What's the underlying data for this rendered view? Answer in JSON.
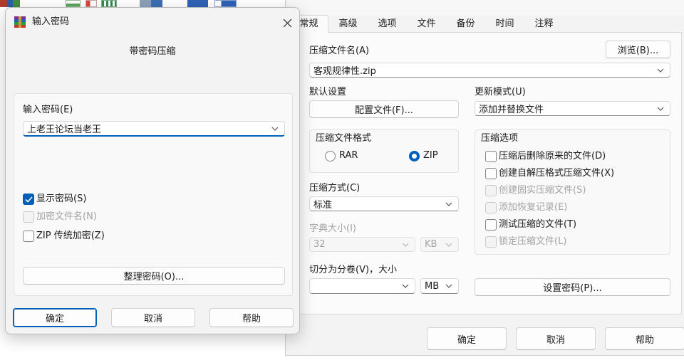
{
  "colors": {
    "accent": "#005fb8"
  },
  "desktop_icons": [
    "archive-file-icon",
    "document-file-icon",
    "image-file-icon",
    "spreadsheet-file-icon",
    "file-icon",
    "word-file-icon",
    "word-file-icon"
  ],
  "archive_dialog": {
    "tabs": [
      {
        "label": "常规",
        "selected": true
      },
      {
        "label": "高级",
        "selected": false
      },
      {
        "label": "选项",
        "selected": false
      },
      {
        "label": "文件",
        "selected": false
      },
      {
        "label": "备份",
        "selected": false
      },
      {
        "label": "时间",
        "selected": false
      },
      {
        "label": "注释",
        "selected": false
      }
    ],
    "archive_name_label": "压缩文件名(A)",
    "browse_button": "浏览(B)...",
    "archive_name_value": "客观规律性.zip",
    "default_settings_label": "默认设置",
    "profiles_button": "配置文件(F)...",
    "update_mode_label": "更新模式(U)",
    "update_mode_value": "添加并替换文件",
    "format_group_label": "压缩文件格式",
    "formats": [
      {
        "label": "RAR",
        "checked": false
      },
      {
        "label": "ZIP",
        "checked": true
      }
    ],
    "method_label": "压缩方式(C)",
    "method_value": "标准",
    "dictionary_label": "字典大小(I)",
    "dictionary_value": "32",
    "dictionary_unit": "KB",
    "dictionary_enabled": false,
    "split_label": "切分为分卷(V)，大小",
    "split_value": "",
    "split_unit": "MB",
    "options_group_label": "压缩选项",
    "options": [
      {
        "label": "压缩后删除原来的文件(D)",
        "checked": false,
        "enabled": true
      },
      {
        "label": "创建自解压格式压缩文件(X)",
        "checked": false,
        "enabled": true
      },
      {
        "label": "创建固实压缩文件(S)",
        "checked": false,
        "enabled": false
      },
      {
        "label": "添加恢复记录(E)",
        "checked": false,
        "enabled": false
      },
      {
        "label": "测试压缩的文件(T)",
        "checked": false,
        "enabled": true
      },
      {
        "label": "锁定压缩文件(L)",
        "checked": false,
        "enabled": false
      }
    ],
    "set_password_button": "设置密码(P)...",
    "ok_button": "确定",
    "cancel_button": "取消",
    "help_button": "帮助"
  },
  "password_dialog": {
    "title": "输入密码",
    "app_icon": "winrar-icon",
    "heading": "带密码压缩",
    "password_label": "输入密码(E)",
    "password_value": "上老王论坛当老王",
    "checkboxes": [
      {
        "label": "显示密码(S)",
        "checked": true,
        "enabled": true
      },
      {
        "label": "加密文件名(N)",
        "checked": false,
        "enabled": false
      },
      {
        "label": "ZIP 传统加密(Z)",
        "checked": false,
        "enabled": true
      }
    ],
    "organize_button": "整理密码(O)...",
    "ok_button": "确定",
    "cancel_button": "取消",
    "help_button": "帮助"
  }
}
